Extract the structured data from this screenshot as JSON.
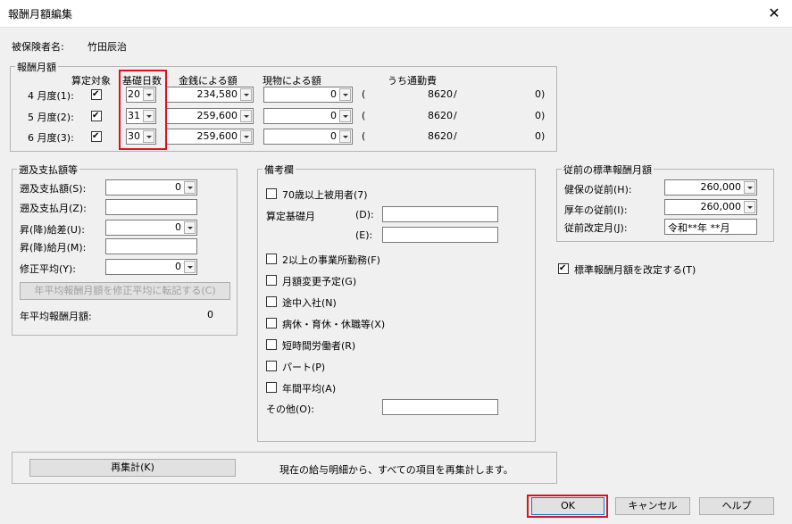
{
  "window": {
    "title": "報酬月額編集",
    "close_glyph": "✕"
  },
  "insured": {
    "label": "被保険者名:",
    "name": "竹田辰治"
  },
  "monthly": {
    "group_title": "報酬月額",
    "headers": {
      "target": "算定対象",
      "days": "基礎日数",
      "cash": "金銭による額",
      "kind": "現物による額",
      "commute": "うち通勤費"
    },
    "rows": [
      {
        "label": "4 月度(1):",
        "checked": true,
        "days": "20",
        "cash": "234,580",
        "kind": "0",
        "paren": "(",
        "commute": "8620",
        "slash": "/",
        "last": "0)"
      },
      {
        "label": "5 月度(2):",
        "checked": true,
        "days": "31",
        "cash": "259,600",
        "kind": "0",
        "paren": "(",
        "commute": "8620",
        "slash": "/",
        "last": "0)"
      },
      {
        "label": "6 月度(3):",
        "checked": true,
        "days": "30",
        "cash": "259,600",
        "kind": "0",
        "paren": "(",
        "commute": "8620",
        "slash": "/",
        "last": "0)"
      }
    ]
  },
  "retro": {
    "group_title": "遡及支払額等",
    "retro_amount_label": "遡及支払額(S):",
    "retro_amount_value": "0",
    "retro_month_label": "遡及支払月(Z):",
    "retro_month_value": "",
    "raise_diff_label": "昇(降)給差(U):",
    "raise_diff_value": "0",
    "raise_month_label": "昇(降)給月(M):",
    "raise_month_value": "",
    "avg_label": "修正平均(Y):",
    "avg_value": "0",
    "transfer_button": "年平均報酬月額を修正平均に転記する(C)",
    "annual_label": "年平均報酬月額:",
    "annual_value": "0"
  },
  "remarks": {
    "group_title": "備考欄",
    "over70": "70歳以上被用者(7)",
    "calc_days_label": "算定基礎月",
    "d_label": "(D):",
    "d_value": "",
    "e_label": "(E):",
    "e_value": "",
    "items": [
      {
        "label": "2以上の事業所勤務(F)",
        "checked": false
      },
      {
        "label": "月額変更予定(G)",
        "checked": false
      },
      {
        "label": "途中入社(N)",
        "checked": false
      },
      {
        "label": "病休・育休・休職等(X)",
        "checked": false
      },
      {
        "label": "短時間労働者(R)",
        "checked": false
      },
      {
        "label": "パート(P)",
        "checked": false
      },
      {
        "label": "年間平均(A)",
        "checked": false
      }
    ],
    "other_label": "その他(O):",
    "other_value": ""
  },
  "previous": {
    "group_title": "従前の標準報酬月額",
    "health_label": "健保の従前(H):",
    "health_value": "260,000",
    "pension_label": "厚年の従前(I):",
    "pension_value": "260,000",
    "revised_label": "従前改定月(J):",
    "revised_value": "令和**年 **月"
  },
  "revise": {
    "label": "標準報酬月額を改定する(T)",
    "checked": true
  },
  "recalc": {
    "button": "再集計(K)",
    "description": "現在の給与明細から、すべての項目を再集計します。"
  },
  "footer": {
    "ok": "OK",
    "cancel": "キャンセル",
    "help": "ヘルプ"
  },
  "colors": {
    "highlight": "#e0101e",
    "background": "#f0f0f0"
  }
}
